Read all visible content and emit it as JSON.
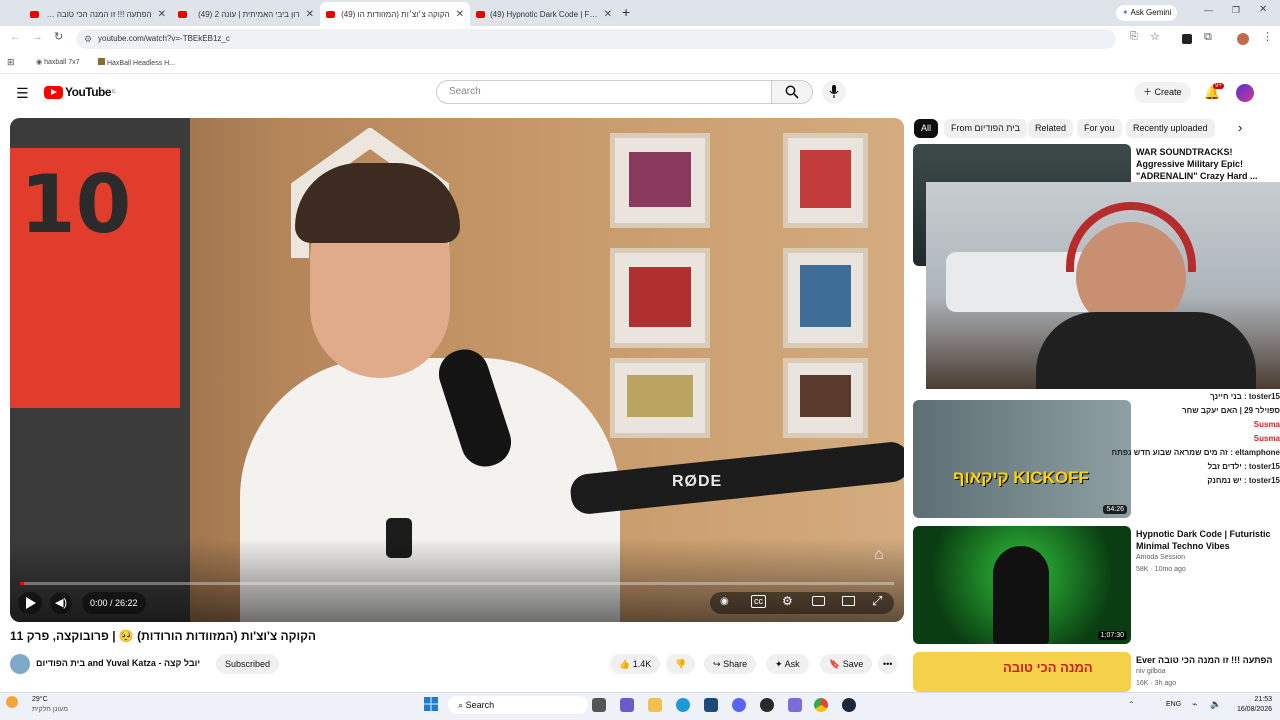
{
  "browser": {
    "tabs": [
      {
        "label": "הפתעה !!! זו המנה הכי טובה (49)"
      },
      {
        "label": "רון ביבי האמיתית | עונה 2 (49)"
      },
      {
        "label": "הקוקה צ׳וצ׳ות (המזוודות הו (49)"
      },
      {
        "label": "(49) Hypnotic Dark Code | Futu"
      }
    ],
    "new_tab": "+",
    "ask_gemini": "Ask Gemini",
    "url": "youtube.com/watch?v=-TBEkEB1z_c",
    "bookmarks": [
      {
        "label": "haxball 7x7"
      },
      {
        "label": "HaxBall Headless H..."
      }
    ]
  },
  "youtube": {
    "logo": "YouTube",
    "logo_region": "IL",
    "search_placeholder": "Search",
    "create_label": "Create",
    "notif_count": "9+",
    "chips": [
      "All",
      "From בית הפודיום",
      "Related",
      "For you",
      "Recently uploaded"
    ],
    "player": {
      "time": "0:00 / 26:22",
      "mic_brand": "RØDE",
      "progress": 0.0
    },
    "video_title": "הקוקה צ'וצ'ות (המזוודות הורודות) 🥺 | פרובוקצה, פרק 11",
    "channel": "בית הפודיום and Yuval Katza - יובל קצה",
    "subscribed_label": "Subscribed",
    "actions": {
      "likes": "1.4K",
      "share": "Share",
      "ask": "Ask",
      "save": "Save"
    },
    "sidebar": [
      {
        "title": "WAR SOUNDTRACKS! Aggressive Military Epic! \"ADRENALIN\" Crazy Hard ..."
      },
      {
        "duration": "54:26",
        "overlay_lines": [
          "toster15 : בני חיינך",
          "ספוילר 29 | האם יעקב שחר",
          "Susma",
          "Susma",
          "eltamphone : זה מים שמראה שבוע חדש נפתח",
          "toster15 : ילדים זבל",
          "toster15 : יש נמחנק"
        ],
        "banner": "קיקאוף KICKOFF"
      },
      {
        "title": "Hypnotic Dark Code | Futuristic Minimal Techno Vibes",
        "channel": "Amoda Session",
        "meta": "58K · 10mo ago",
        "duration": "1:07:30"
      },
      {
        "title": "הפתעה !!! זו המנה הכי טובה Ever",
        "channel": "niv gilboa",
        "meta": "16K · 3h ago",
        "banner": "המנה הכי טובה"
      }
    ]
  },
  "taskbar": {
    "weather_temp": "29°C",
    "weather_desc": "מעונן חלקית",
    "search_label": "Search",
    "lang": "ENG",
    "time": "21:53",
    "date": "16/08/2026"
  },
  "colors": {
    "yt_red": "#ff0000",
    "tab_bar": "#dfe3ea",
    "link_blue": "#065fd4"
  }
}
